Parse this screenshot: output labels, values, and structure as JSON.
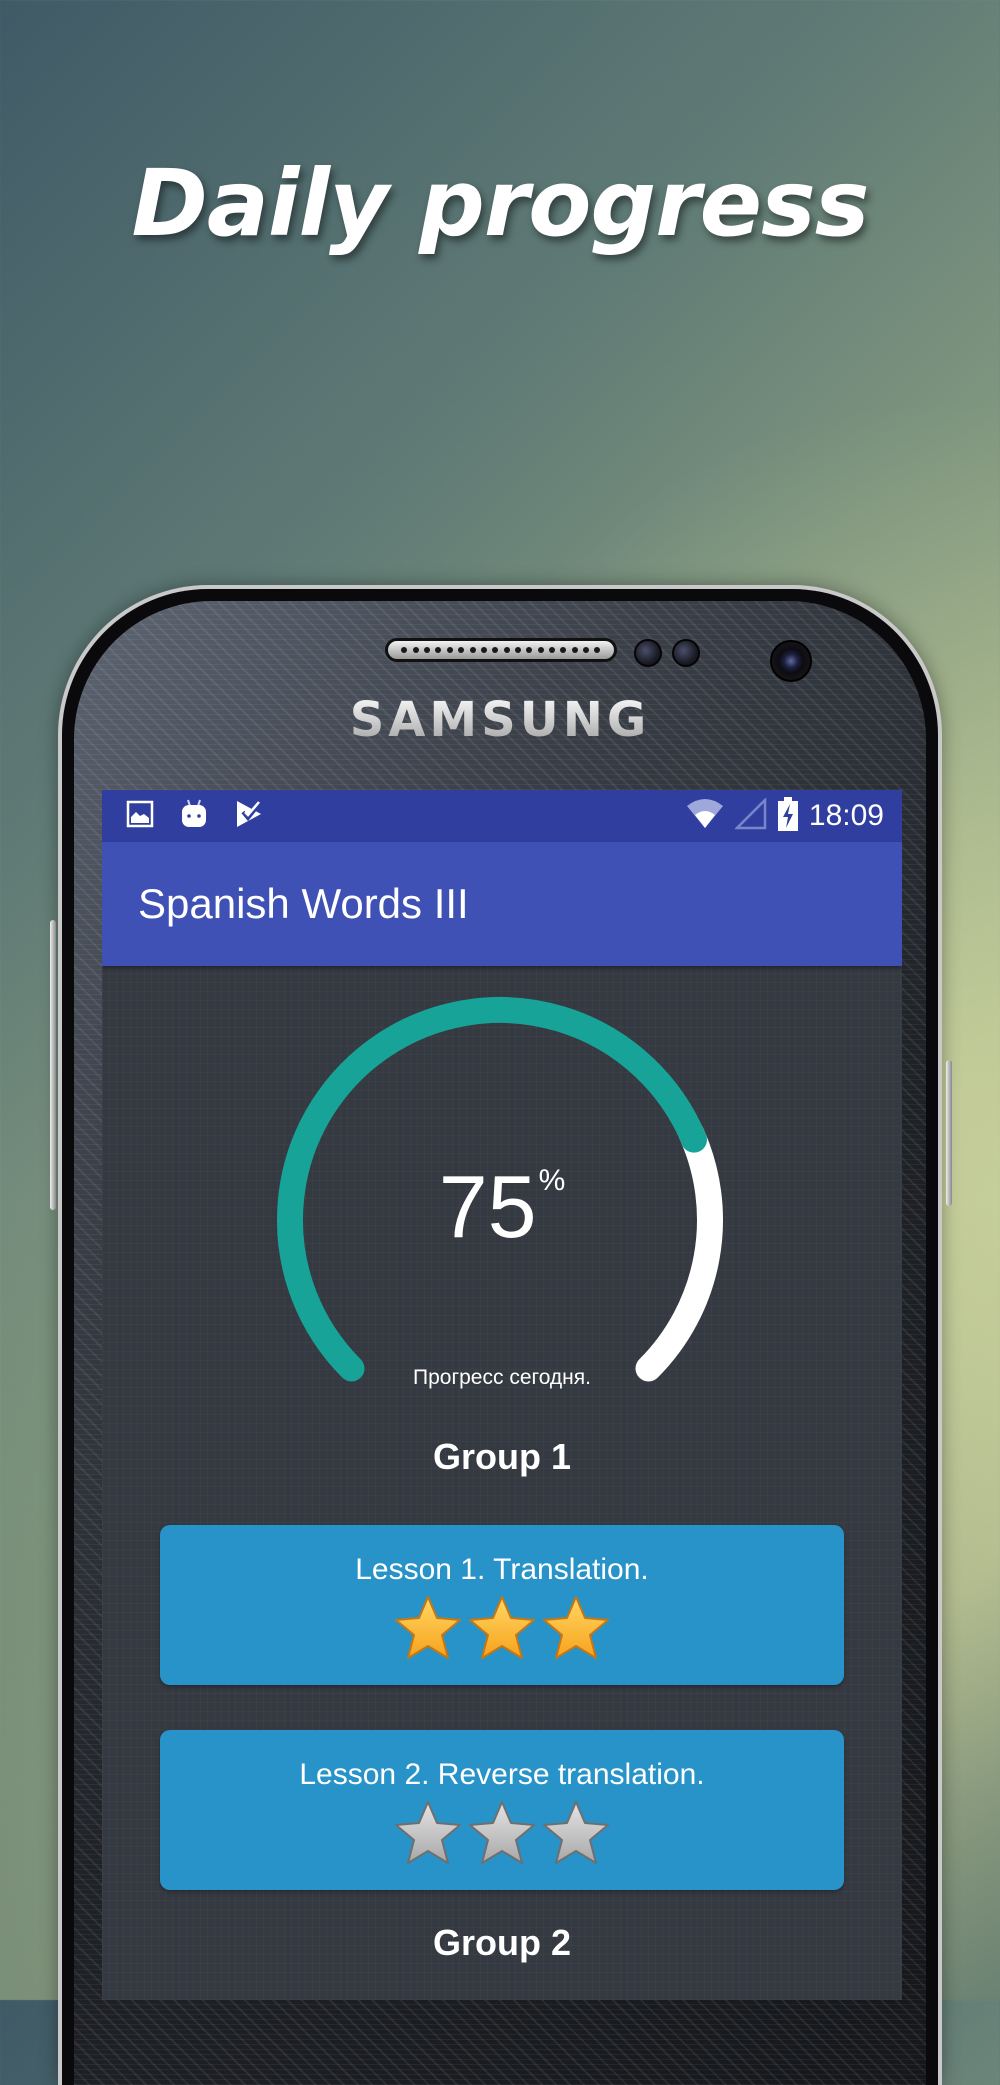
{
  "promo": {
    "headline": "Daily progress",
    "device_brand": "SAMSUNG"
  },
  "status_bar": {
    "left_icons": [
      "image-notification-icon",
      "android-debug-icon",
      "play-store-check-icon"
    ],
    "right_icons": [
      "wifi-icon",
      "cell-signal-icon",
      "battery-charging-icon"
    ],
    "time": "18:09"
  },
  "app_bar": {
    "title": "Spanish Words III"
  },
  "progress": {
    "value_percent": 75,
    "value_text": "75",
    "unit": "%",
    "caption": "Прогресс сегодня.",
    "colors": {
      "filled": "#17a398",
      "remaining": "#ffffff"
    }
  },
  "groups": [
    {
      "title": "Group 1",
      "lessons": [
        {
          "label": "Lesson 1. Translation.",
          "stars_earned": 3,
          "stars_total": 3
        },
        {
          "label": "Lesson 2. Reverse translation.",
          "stars_earned": 0,
          "stars_total": 3
        }
      ]
    },
    {
      "title": "Group 2",
      "lessons": []
    }
  ],
  "colors": {
    "status_bar": "#303f9f",
    "app_bar": "#3f51b5",
    "card": "#2893c8",
    "star_gold": "#f7a21b",
    "star_gray": "#a8a8a8"
  }
}
